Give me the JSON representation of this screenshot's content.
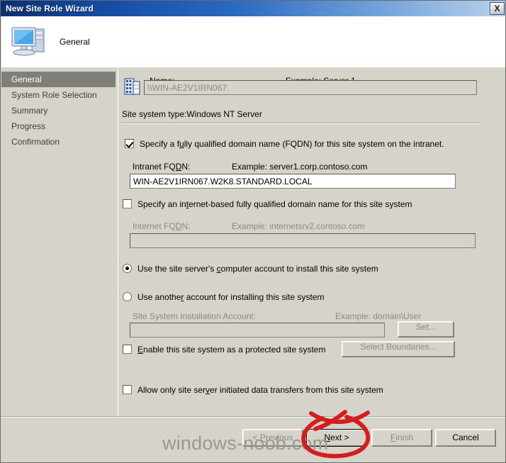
{
  "window": {
    "title": "New Site Role Wizard",
    "close_label": "X"
  },
  "header": {
    "title": "General",
    "icon": "computer-icon"
  },
  "sidebar": {
    "items": [
      {
        "label": "General",
        "active": true
      },
      {
        "label": "System Role Selection",
        "active": false
      },
      {
        "label": "Summary",
        "active": false
      },
      {
        "label": "Progress",
        "active": false
      },
      {
        "label": "Confirmation",
        "active": false
      }
    ]
  },
  "main": {
    "name_section": {
      "icon": "server-rack-icon",
      "label": "Name:",
      "example": "Example: Server 1",
      "value": "\\\\WIN-AE2V1IRN067",
      "placeholder": ""
    },
    "site_system_type": "Site system type:Windows NT Server",
    "intranet_fqdn": {
      "checkbox_label_pre": "Specify a f",
      "checkbox_label_acc": "u",
      "checkbox_label_post": "lly qualified domain name (FQDN) for this site system on the intranet.",
      "checkbox_label_full": "Specify a fully qualified domain name (FQDN) for this site system on the intranet.",
      "checked": true,
      "label": "Intranet FQDN:",
      "example": "Example: server1.corp.contoso.com",
      "value": "WIN-AE2V1IRN067.W2K8.STANDARD.LOCAL"
    },
    "internet_fqdn": {
      "checkbox_label_full": "Specify an internet-based fully qualified domain name for this site system",
      "checked": false,
      "label": "Internet FQDN:",
      "example": "Example: internetsrv2.contoso.com",
      "value": "",
      "disabled": true
    },
    "account_options": {
      "option_computer_account": "Use the site server's computer account to install this site system",
      "option_another_account": "Use another account for installing this site system",
      "selected": "computer_account",
      "install_account_label": "Site System Installation Account:",
      "install_account_example": "Example: domain\\User",
      "install_account_value": "",
      "set_button": "Set..."
    },
    "protected_site": {
      "label": "Enable this site system as a protected site system",
      "checked": false,
      "boundaries_button": "Select Boundaries..."
    },
    "allow_only": {
      "label": "Allow only site server initiated data transfers from this site system",
      "checked": false
    }
  },
  "footer": {
    "previous": "< Previous",
    "next": "Next >",
    "finish": "Finish",
    "cancel": "Cancel",
    "previous_disabled": true,
    "finish_disabled": true
  },
  "watermark": {
    "text": "windows-noob.com"
  },
  "annotation": {
    "shape": "hand-drawn-red-circle",
    "color": "#d41e1e",
    "target": "Next >"
  },
  "colors": {
    "title_bar": "#12479e",
    "dialog_face": "#d6d3ca",
    "sidebar_active": "#7f7f79",
    "annotation_red": "#d41e1e"
  }
}
